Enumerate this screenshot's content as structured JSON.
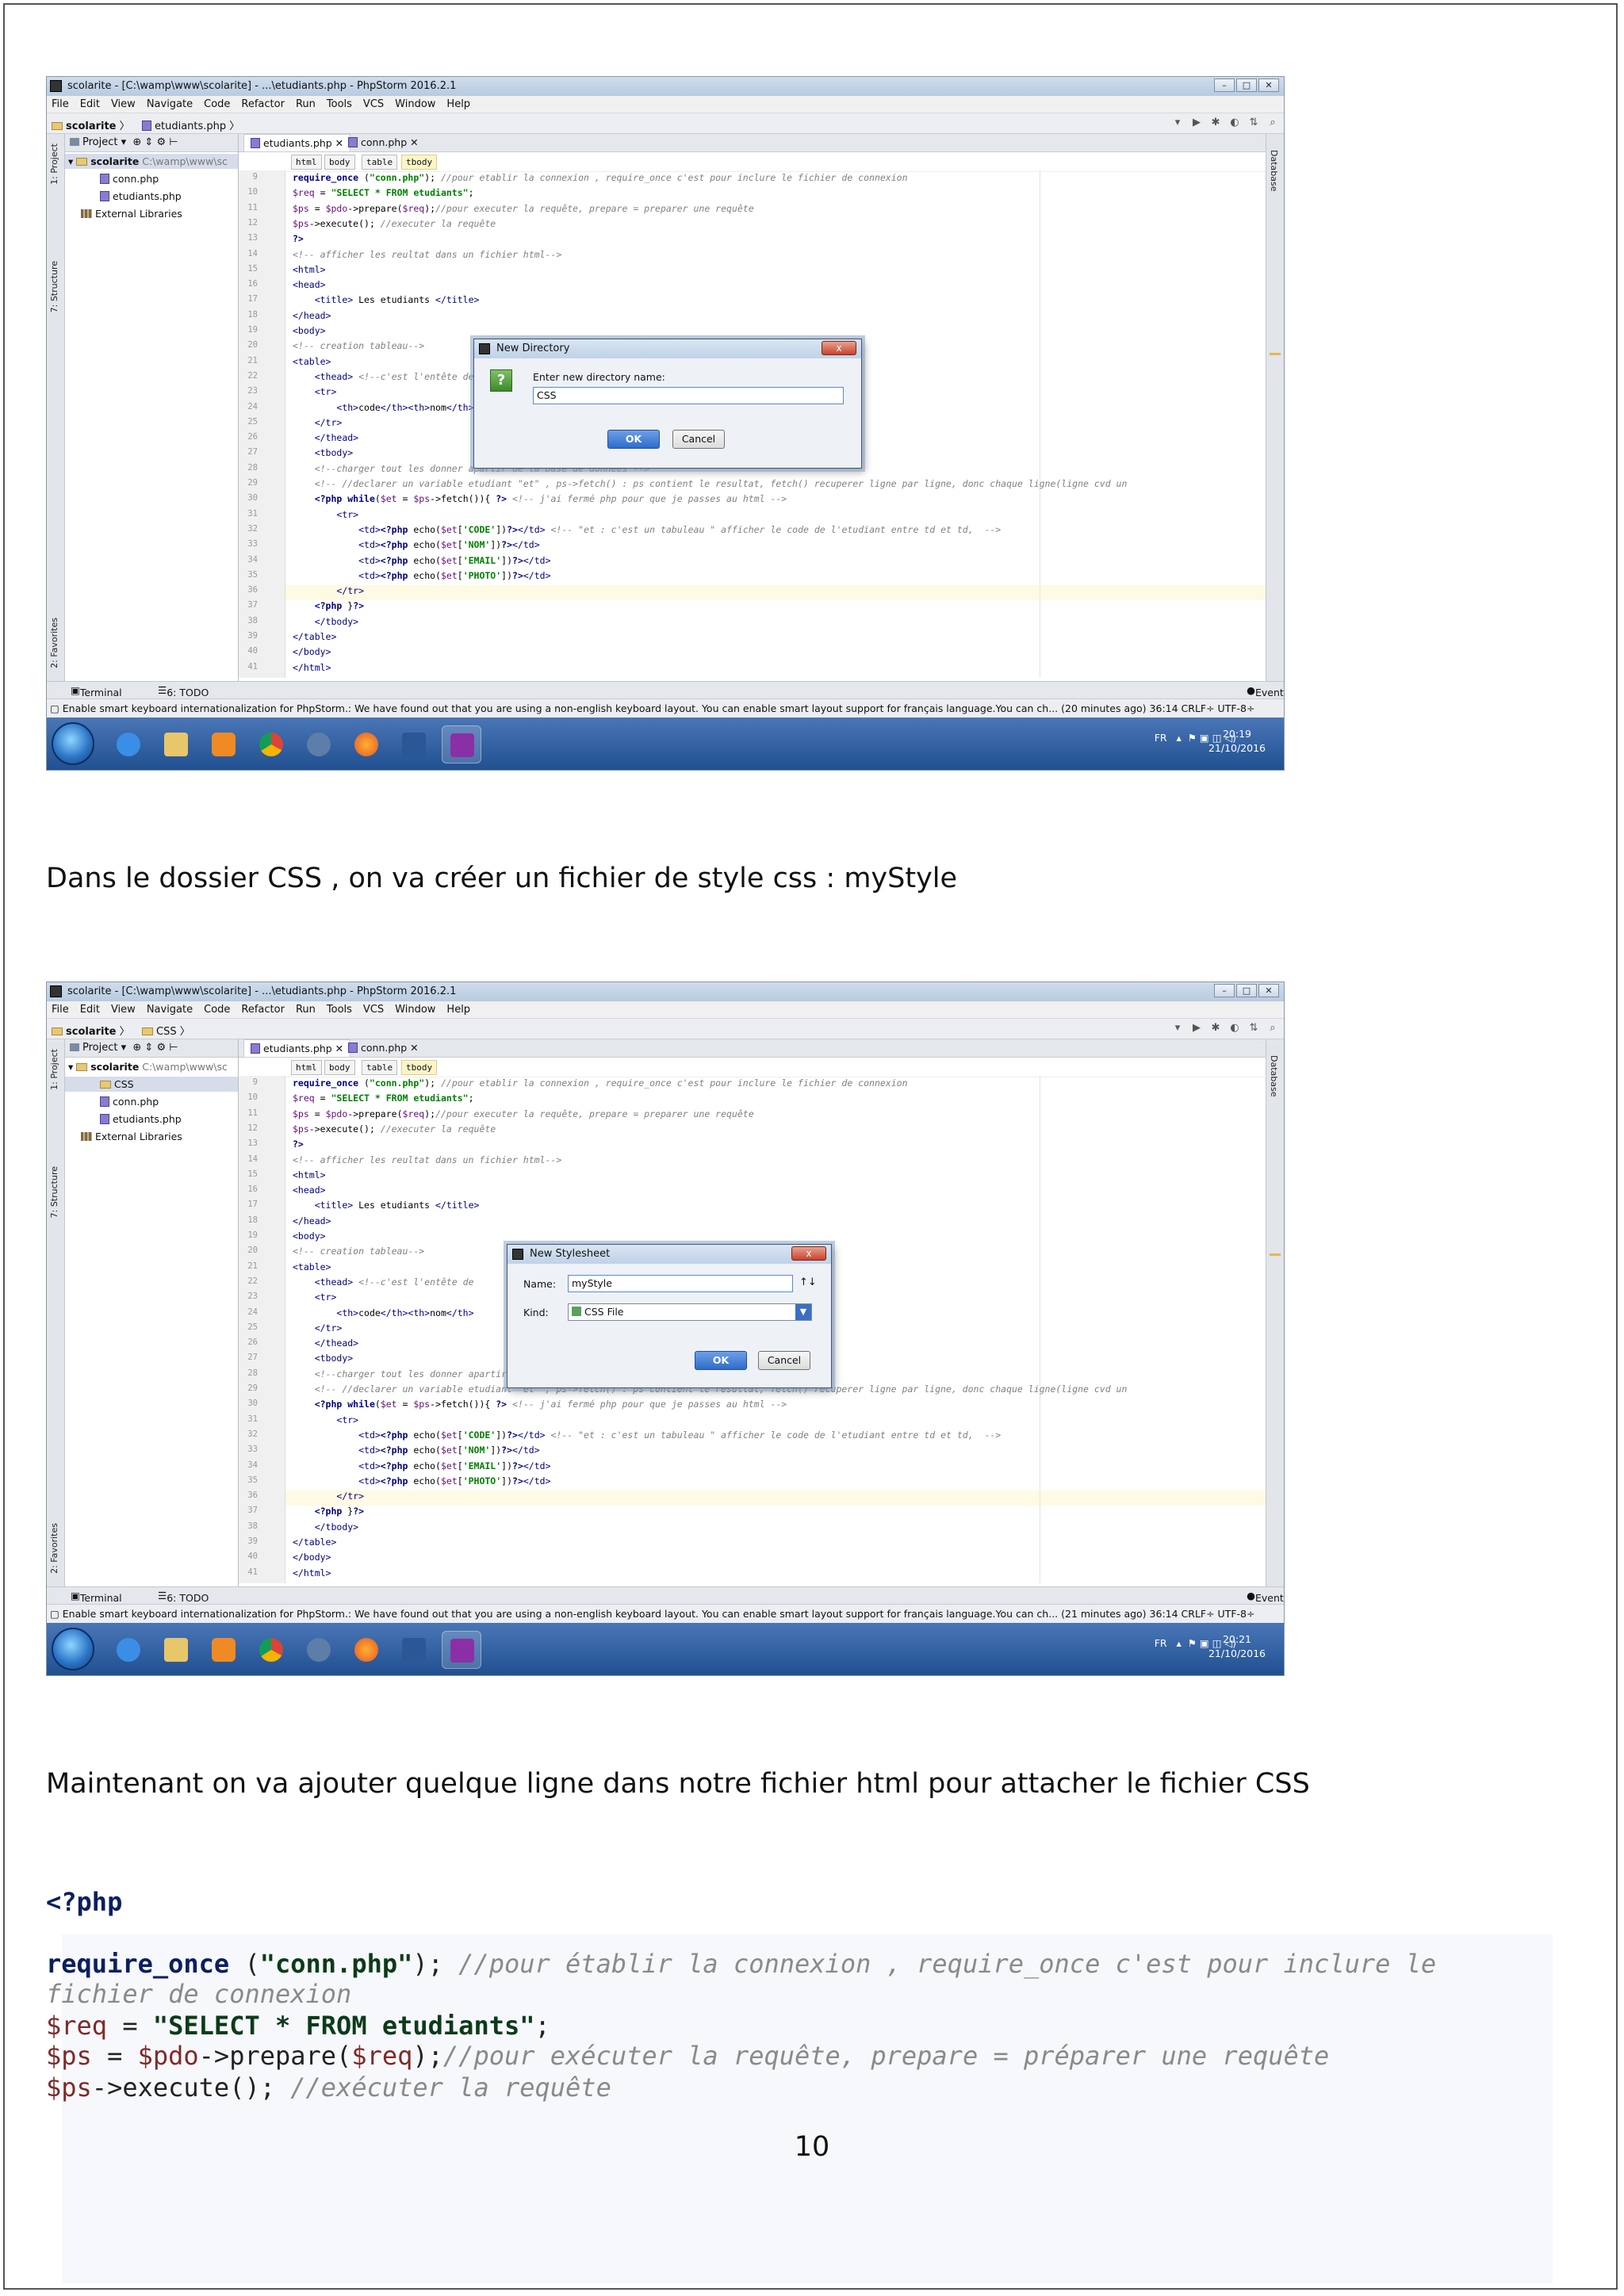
{
  "screens": [
    {
      "window_title": "scolarite - [C:\\wamp\\www\\scolarite] - ...\\etudiants.php - PhpStorm 2016.2.1",
      "menu": [
        "File",
        "Edit",
        "View",
        "Navigate",
        "Code",
        "Refactor",
        "Run",
        "Tools",
        "VCS",
        "Window",
        "Help"
      ],
      "breadcrumb": [
        "scolarite",
        "etudiants.php"
      ],
      "project_label": "Project",
      "tree": {
        "root": "scolarite",
        "root_path": "C:\\wamp\\www\\sc",
        "items": [
          "conn.php",
          "etudiants.php"
        ],
        "libraries": "External Libraries"
      },
      "tabs": [
        "etudiants.php",
        "conn.php"
      ],
      "html_crumbs": [
        "html",
        "body",
        "table",
        "tbody"
      ],
      "side_tabs": [
        "1: Project",
        "7: Structure",
        "2: Favorites"
      ],
      "right_tab": "Database",
      "bottom": {
        "terminal": "Terminal",
        "todo": "6: TODO",
        "event_log": "Event Log"
      },
      "status": "Enable smart keyboard internationalization for PhpStorm.: We have found out that you are using a non-english keyboard layout. You can enable smart layout support for français language.You can ch... (20 minutes ago)   36:14   CRLF÷   UTF-8÷",
      "tray": {
        "lang": "FR",
        "time": "20:19",
        "date": "21/10/2016"
      }
    },
    {
      "window_title": "scolarite - [C:\\wamp\\www\\scolarite] - ...\\etudiants.php - PhpStorm 2016.2.1",
      "menu": [
        "File",
        "Edit",
        "View",
        "Navigate",
        "Code",
        "Refactor",
        "Run",
        "Tools",
        "VCS",
        "Window",
        "Help"
      ],
      "breadcrumb": [
        "scolarite",
        "CSS"
      ],
      "project_label": "Project",
      "tree": {
        "root": "scolarite",
        "root_path": "C:\\wamp\\www\\sc",
        "items": [
          "CSS",
          "conn.php",
          "etudiants.php"
        ],
        "libraries": "External Libraries"
      },
      "tabs": [
        "etudiants.php",
        "conn.php"
      ],
      "html_crumbs": [
        "html",
        "body",
        "table",
        "tbody"
      ],
      "side_tabs": [
        "1: Project",
        "7: Structure",
        "2: Favorites"
      ],
      "right_tab": "Database",
      "bottom": {
        "terminal": "Terminal",
        "todo": "6: TODO",
        "event_log": "Event Log"
      },
      "status": "Enable smart keyboard internationalization for PhpStorm.: We have found out that you are using a non-english keyboard layout. You can enable smart layout support for français language.You can ch... (21 minutes ago)   36:14   CRLF÷   UTF-8÷",
      "tray": {
        "lang": "FR",
        "time": "20:21",
        "date": "21/10/2016"
      }
    }
  ],
  "code_lines": [
    {
      "n": "9",
      "parts": [
        [
          "k",
          "require_once "
        ],
        [
          "p",
          "("
        ],
        [
          "s",
          "\"conn.php\""
        ],
        [
          "p",
          "); "
        ],
        [
          "c",
          "//pour etablir la connexion , require_once c'est pour inclure le fichier de connexion"
        ]
      ]
    },
    {
      "n": "10",
      "parts": [
        [
          "v",
          "$req"
        ],
        [
          "p",
          " = "
        ],
        [
          "s",
          "\"SELECT * FROM etudiants\""
        ],
        [
          "p",
          ";"
        ]
      ]
    },
    {
      "n": "11",
      "parts": [
        [
          "v",
          "$ps"
        ],
        [
          "p",
          " = "
        ],
        [
          "v",
          "$pdo"
        ],
        [
          "p",
          "->prepare("
        ],
        [
          "v",
          "$req"
        ],
        [
          "p",
          ");"
        ],
        [
          "c",
          "//pour executer la requête, prepare = preparer une requête"
        ]
      ]
    },
    {
      "n": "12",
      "parts": [
        [
          "v",
          "$ps"
        ],
        [
          "p",
          "->execute(); "
        ],
        [
          "c",
          "//executer la requête"
        ]
      ]
    },
    {
      "n": "13",
      "parts": [
        [
          "k",
          "?>"
        ]
      ]
    },
    {
      "n": "14",
      "parts": [
        [
          "c",
          "<!-- afficher les reultat dans un fichier html-->"
        ]
      ]
    },
    {
      "n": "15",
      "parts": [
        [
          "t",
          "<html>"
        ]
      ]
    },
    {
      "n": "16",
      "parts": [
        [
          "t",
          "<head>"
        ]
      ]
    },
    {
      "n": "17",
      "parts": [
        [
          "p",
          "    "
        ],
        [
          "t",
          "<title>"
        ],
        [
          "p",
          " Les etudiants "
        ],
        [
          "t",
          "</title>"
        ]
      ]
    },
    {
      "n": "18",
      "parts": [
        [
          "t",
          "</head>"
        ]
      ]
    },
    {
      "n": "19",
      "parts": [
        [
          "t",
          "<body>"
        ]
      ]
    },
    {
      "n": "20",
      "parts": [
        [
          "c",
          "<!-- creation tableau-->"
        ]
      ]
    },
    {
      "n": "21",
      "parts": [
        [
          "t",
          "<table>"
        ]
      ]
    },
    {
      "n": "22",
      "parts": [
        [
          "p",
          "    "
        ],
        [
          "t",
          "<thead>"
        ],
        [
          "c",
          " <!--c'est l'entête de"
        ]
      ]
    },
    {
      "n": "23",
      "parts": [
        [
          "p",
          "    "
        ],
        [
          "t",
          "<tr>"
        ]
      ]
    },
    {
      "n": "24",
      "parts": [
        [
          "p",
          "        "
        ],
        [
          "t",
          "<th>"
        ],
        [
          "p",
          "code"
        ],
        [
          "t",
          "</th><th>"
        ],
        [
          "p",
          "nom"
        ],
        [
          "t",
          "</th>"
        ]
      ]
    },
    {
      "n": "25",
      "parts": [
        [
          "p",
          "    "
        ],
        [
          "t",
          "</tr>"
        ]
      ]
    },
    {
      "n": "26",
      "parts": [
        [
          "p",
          "    "
        ],
        [
          "t",
          "</thead>"
        ]
      ]
    },
    {
      "n": "27",
      "parts": [
        [
          "p",
          "    "
        ],
        [
          "t",
          "<tbody>"
        ]
      ]
    },
    {
      "n": "28",
      "parts": [
        [
          "p",
          "    "
        ],
        [
          "c",
          "<!--charger tout les donner apartir de la base de donnees -->"
        ]
      ]
    },
    {
      "n": "29",
      "parts": [
        [
          "p",
          "    "
        ],
        [
          "c",
          "<!-- //declarer un variable etudiant \"et\" , ps->fetch() : ps contient le resultat, fetch() recuperer ligne par ligne, donc chaque ligne(ligne cvd un"
        ]
      ]
    },
    {
      "n": "30",
      "parts": [
        [
          "p",
          "    "
        ],
        [
          "k",
          "<?php "
        ],
        [
          "k",
          "while"
        ],
        [
          "p",
          "("
        ],
        [
          "v",
          "$et"
        ],
        [
          "p",
          " = "
        ],
        [
          "v",
          "$ps"
        ],
        [
          "p",
          "->fetch()){ "
        ],
        [
          "k",
          "?>"
        ],
        [
          "c",
          " <!-- j'ai fermé php pour que je passes au html -->"
        ]
      ]
    },
    {
      "n": "31",
      "parts": [
        [
          "p",
          "        "
        ],
        [
          "t",
          "<tr>"
        ]
      ]
    },
    {
      "n": "32",
      "parts": [
        [
          "p",
          "            "
        ],
        [
          "t",
          "<td>"
        ],
        [
          "k",
          "<?php "
        ],
        [
          "p",
          "echo("
        ],
        [
          "v",
          "$et"
        ],
        [
          "p",
          "["
        ],
        [
          "s",
          "'CODE'"
        ],
        [
          "p",
          "])"
        ],
        [
          "k",
          "?>"
        ],
        [
          "t",
          "</td>"
        ],
        [
          "c",
          " <!-- \"et : c'est un tabuleau \" afficher le code de l'etudiant entre td et td,  -->"
        ]
      ]
    },
    {
      "n": "33",
      "parts": [
        [
          "p",
          "            "
        ],
        [
          "t",
          "<td>"
        ],
        [
          "k",
          "<?php "
        ],
        [
          "p",
          "echo("
        ],
        [
          "v",
          "$et"
        ],
        [
          "p",
          "["
        ],
        [
          "s",
          "'NOM'"
        ],
        [
          "p",
          "])"
        ],
        [
          "k",
          "?>"
        ],
        [
          "t",
          "</td>"
        ]
      ]
    },
    {
      "n": "34",
      "parts": [
        [
          "p",
          "            "
        ],
        [
          "t",
          "<td>"
        ],
        [
          "k",
          "<?php "
        ],
        [
          "p",
          "echo("
        ],
        [
          "v",
          "$et"
        ],
        [
          "p",
          "["
        ],
        [
          "s",
          "'EMAIL'"
        ],
        [
          "p",
          "])"
        ],
        [
          "k",
          "?>"
        ],
        [
          "t",
          "</td>"
        ]
      ]
    },
    {
      "n": "35",
      "parts": [
        [
          "p",
          "            "
        ],
        [
          "t",
          "<td>"
        ],
        [
          "k",
          "<?php "
        ],
        [
          "p",
          "echo("
        ],
        [
          "v",
          "$et"
        ],
        [
          "p",
          "["
        ],
        [
          "s",
          "'PHOTO'"
        ],
        [
          "p",
          "])"
        ],
        [
          "k",
          "?>"
        ],
        [
          "t",
          "</td>"
        ]
      ]
    },
    {
      "n": "36",
      "parts": [
        [
          "p",
          "        "
        ],
        [
          "t",
          "</tr>"
        ]
      ]
    },
    {
      "n": "37",
      "parts": [
        [
          "p",
          "    "
        ],
        [
          "k",
          "<?php "
        ],
        [
          "p",
          "}"
        ],
        [
          "k",
          "?>"
        ]
      ]
    },
    {
      "n": "38",
      "parts": [
        [
          "p",
          "    "
        ],
        [
          "t",
          "</tbody>"
        ]
      ]
    },
    {
      "n": "39",
      "parts": [
        [
          "t",
          "</table>"
        ]
      ]
    },
    {
      "n": "40",
      "parts": [
        [
          "t",
          "</body>"
        ]
      ]
    },
    {
      "n": "41",
      "parts": [
        [
          "t",
          "</html>"
        ]
      ]
    }
  ],
  "dialog1": {
    "title": "New Directory",
    "close": "x",
    "prompt": "Enter new directory name:",
    "value": "CSS",
    "ok": "OK",
    "cancel": "Cancel"
  },
  "dialog2": {
    "title": "New Stylesheet",
    "close": "x",
    "name_label": "Name:",
    "name_value": "myStyle",
    "sort": "↑↓",
    "kind_label": "Kind:",
    "kind_value": "CSS File",
    "ok": "OK",
    "cancel": "Cancel"
  },
  "doc": {
    "para1": "Dans le dossier CSS , on va créer un fichier de style css : myStyle",
    "para2": "Maintenant on va ajouter quelque ligne dans notre fichier html pour attacher le fichier CSS",
    "src_lines": [
      [
        [
          "k",
          "<?php"
        ]
      ],
      [],
      [
        [
          "k",
          "require_once "
        ],
        [
          "p",
          "("
        ],
        [
          "s",
          "\"conn.php\""
        ],
        [
          "p",
          "); "
        ],
        [
          "c",
          "//pour établir la connexion , require_once c'est pour inclure le"
        ]
      ],
      [
        [
          "c",
          "fichier de connexion"
        ]
      ],
      [
        [
          "v",
          "$req"
        ],
        [
          "p",
          " = "
        ],
        [
          "s",
          "\"SELECT * FROM etudiants\""
        ],
        [
          "p",
          ";"
        ]
      ],
      [
        [
          "v",
          "$ps"
        ],
        [
          "p",
          " = "
        ],
        [
          "v",
          "$pdo"
        ],
        [
          "p",
          "->prepare("
        ],
        [
          "v",
          "$req"
        ],
        [
          "p",
          ");"
        ],
        [
          "c",
          "//pour exécuter la requête, prepare = préparer une requête"
        ]
      ],
      [
        [
          "v",
          "$ps"
        ],
        [
          "p",
          "->execute(); "
        ],
        [
          "c",
          "//exécuter la requête"
        ]
      ]
    ],
    "page_number": "10"
  },
  "colors": {
    "taskbar": "#2a5a9e",
    "keyword": "#000080",
    "string": "#008000",
    "comment": "#808080"
  }
}
